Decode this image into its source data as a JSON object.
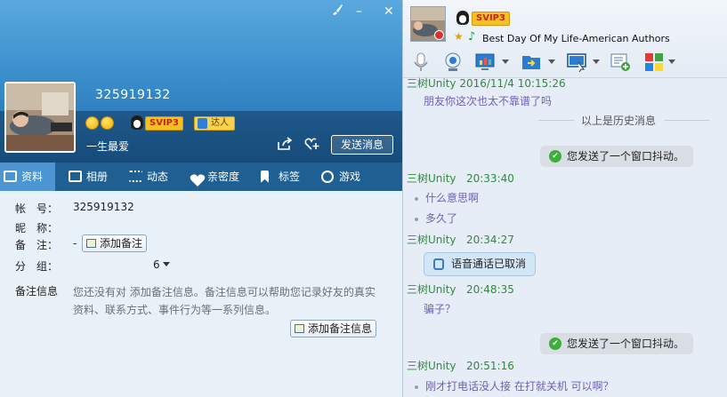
{
  "window": {
    "skin_icon": "brush-icon",
    "minimize_label": "–",
    "close_label": "✕"
  },
  "profile": {
    "qq_number": "325919132",
    "vip_label": "SVIP3",
    "expert_label": "达人",
    "signature": "一生最爱",
    "send_message_label": "发送消息"
  },
  "tabs": [
    {
      "label": "资料",
      "icon": "id-card-icon",
      "active": true
    },
    {
      "label": "相册",
      "icon": "photo-album-icon"
    },
    {
      "label": "动态",
      "icon": "feed-list-icon"
    },
    {
      "label": "亲密度",
      "icon": "heart-icon"
    },
    {
      "label": "标签",
      "icon": "bookmark-icon"
    },
    {
      "label": "游戏",
      "icon": "game-icon"
    }
  ],
  "info": {
    "account_label": "帐　号：",
    "account_value": "325919132",
    "nickname_label": "昵　称：",
    "remark_label": "备　注：",
    "remark_value": "-",
    "add_remark_button": "添加备注",
    "group_label": "分　组：",
    "group_value": "6",
    "remark_info_label": "备注信息",
    "remark_info_text": "您还没有对  添加备注信息。备注信息可以帮助您记录好友的真实资料、联系方式、事件行为等一系列信息。",
    "add_remark_info_button": "添加备注信息"
  },
  "chat_header": {
    "vip_label": "SVIP3",
    "song": "Best Day Of My Life-American Authors"
  },
  "chat": {
    "history_header": "三树Unity   2016/11/4 10:15:26",
    "history_message": "朋友你这次也太不靠谱了吗",
    "history_separator": "以上是历史消息",
    "shake_notice": "您发送了一个窗口抖动。",
    "messages": [
      {
        "sender": "三树Unity",
        "time": "20:33:40",
        "lines": [
          "什么意思啊",
          "多久了"
        ]
      },
      {
        "sender": "三树Unity",
        "time": "20:34:27",
        "call": "语音通话已取消"
      },
      {
        "sender": "三树Unity",
        "time": "20:48:35",
        "lines": [
          "骗子？"
        ]
      },
      {
        "sender": "三树Unity",
        "time": "20:51:16",
        "lines": [
          "刚才打电话没人接 在打就关机 可以啊？"
        ]
      }
    ]
  },
  "colors": {
    "banner": "#3e92cf",
    "tab_bar": "#1f5f92",
    "active_tab": "#4a95d2",
    "sender": "#2e8b3c",
    "message": "#6f5fb6"
  }
}
